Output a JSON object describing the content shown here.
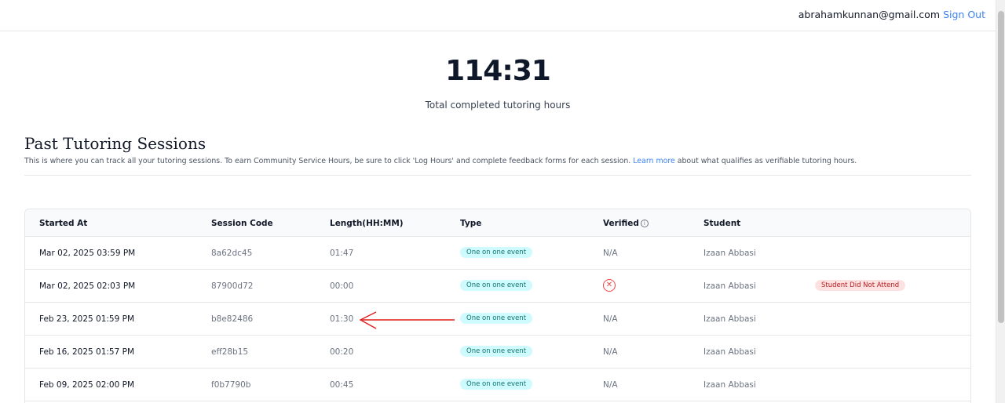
{
  "header": {
    "user_email": "abrahamkunnan@gmail.com",
    "sign_out_label": "Sign Out"
  },
  "summary": {
    "total_hours": "114:31",
    "total_label": "Total completed tutoring hours"
  },
  "section": {
    "title": "Past Tutoring Sessions",
    "description_before": "This is where you can track all your tutoring sessions. To earn Community Service Hours, be sure to click 'Log Hours' and complete feedback forms for each session.",
    "learn_more": "Learn more",
    "description_after": "about what qualifies as verifiable tutoring hours."
  },
  "table": {
    "headers": {
      "started_at": "Started At",
      "session_code": "Session Code",
      "length": "Length(HH:MM)",
      "type": "Type",
      "verified": "Verified",
      "student": "Student"
    },
    "rows": [
      {
        "started_at": "Mar 02, 2025 03:59 PM",
        "session_code": "8a62dc45",
        "length": "01:47",
        "type": "One on one event",
        "verified": "N/A",
        "student": "Izaan Abbasi",
        "status": ""
      },
      {
        "started_at": "Mar 02, 2025 02:03 PM",
        "session_code": "87900d72",
        "length": "00:00",
        "type": "One on one event",
        "verified": "",
        "student": "Izaan Abbasi",
        "status": "Student Did Not Attend"
      },
      {
        "started_at": "Feb 23, 2025 01:59 PM",
        "session_code": "b8e82486",
        "length": "01:30",
        "type": "One on one event",
        "verified": "N/A",
        "student": "Izaan Abbasi",
        "status": ""
      },
      {
        "started_at": "Feb 16, 2025 01:57 PM",
        "session_code": "eff28b15",
        "length": "00:20",
        "type": "One on one event",
        "verified": "N/A",
        "student": "Izaan Abbasi",
        "status": ""
      },
      {
        "started_at": "Feb 09, 2025 02:00 PM",
        "session_code": "f0b7790b",
        "length": "00:45",
        "type": "One on one event",
        "verified": "N/A",
        "student": "Izaan Abbasi",
        "status": ""
      }
    ]
  },
  "icons": {
    "info": "info-icon",
    "not_verified": "x-circle-icon",
    "annotation": "red-arrow-icon"
  },
  "colors": {
    "accent": "#3b82f6",
    "badge_bg": "#cffafe",
    "danger": "#ef4444"
  }
}
